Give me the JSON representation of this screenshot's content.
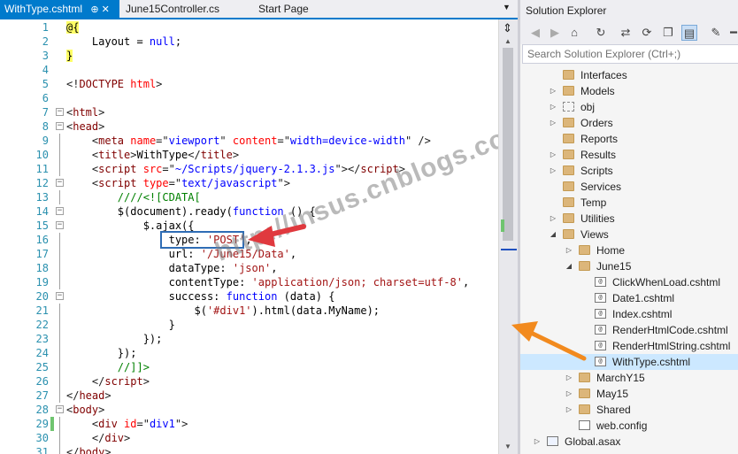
{
  "tabs": [
    {
      "label": "WithType.cshtml",
      "icons": "⊕ ✕"
    },
    {
      "label": "June15Controller.cs"
    },
    {
      "label": "Start Page"
    }
  ],
  "code": [
    {
      "num": "1",
      "tokens": [
        {
          "t": "@{",
          "c": "razor"
        }
      ]
    },
    {
      "num": "2",
      "tokens": [
        {
          "t": "    Layout = ",
          "c": "r"
        },
        {
          "t": "null",
          "c": "k"
        },
        {
          "t": ";",
          "c": "r"
        }
      ]
    },
    {
      "num": "3",
      "tokens": [
        {
          "t": "}",
          "c": "razor"
        }
      ]
    },
    {
      "num": "4",
      "tokens": []
    },
    {
      "num": "5",
      "tokens": [
        {
          "t": "<!",
          "c": "p"
        },
        {
          "t": "DOCTYPE",
          "c": "e"
        },
        {
          "t": " ",
          "c": "r"
        },
        {
          "t": "html",
          "c": "a"
        },
        {
          "t": ">",
          "c": "p"
        }
      ]
    },
    {
      "num": "6",
      "tokens": []
    },
    {
      "num": "7",
      "tokens": [
        {
          "t": "<",
          "c": "p"
        },
        {
          "t": "html",
          "c": "e"
        },
        {
          "t": ">",
          "c": "p"
        }
      ]
    },
    {
      "num": "8",
      "tokens": [
        {
          "t": "<",
          "c": "p"
        },
        {
          "t": "head",
          "c": "e"
        },
        {
          "t": ">",
          "c": "p"
        }
      ]
    },
    {
      "num": "9",
      "tokens": [
        {
          "t": "    <",
          "c": "p"
        },
        {
          "t": "meta",
          "c": "e"
        },
        {
          "t": " ",
          "c": "r"
        },
        {
          "t": "name",
          "c": "a"
        },
        {
          "t": "=\"",
          "c": "p"
        },
        {
          "t": "viewport",
          "c": "s"
        },
        {
          "t": "\"",
          "c": "p"
        },
        {
          "t": " ",
          "c": "r"
        },
        {
          "t": "content",
          "c": "a"
        },
        {
          "t": "=\"",
          "c": "p"
        },
        {
          "t": "width=device-width",
          "c": "s"
        },
        {
          "t": "\"",
          "c": "p"
        },
        {
          "t": " />",
          "c": "p"
        }
      ]
    },
    {
      "num": "10",
      "tokens": [
        {
          "t": "    <",
          "c": "p"
        },
        {
          "t": "title",
          "c": "e"
        },
        {
          "t": ">",
          "c": "p"
        },
        {
          "t": "WithType",
          "c": "r"
        },
        {
          "t": "</",
          "c": "p"
        },
        {
          "t": "title",
          "c": "e"
        },
        {
          "t": ">",
          "c": "p"
        }
      ]
    },
    {
      "num": "11",
      "tokens": [
        {
          "t": "    <",
          "c": "p"
        },
        {
          "t": "script",
          "c": "e"
        },
        {
          "t": " ",
          "c": "r"
        },
        {
          "t": "src",
          "c": "a"
        },
        {
          "t": "=\"",
          "c": "p"
        },
        {
          "t": "~/Scripts/jquery-2.1.3.js",
          "c": "s"
        },
        {
          "t": "\"",
          "c": "p"
        },
        {
          "t": "></",
          "c": "p"
        },
        {
          "t": "script",
          "c": "e"
        },
        {
          "t": ">",
          "c": "p"
        }
      ]
    },
    {
      "num": "12",
      "tokens": [
        {
          "t": "    <",
          "c": "p"
        },
        {
          "t": "script",
          "c": "e"
        },
        {
          "t": " ",
          "c": "r"
        },
        {
          "t": "type",
          "c": "a"
        },
        {
          "t": "=\"",
          "c": "p"
        },
        {
          "t": "text/javascript",
          "c": "s"
        },
        {
          "t": "\"",
          "c": "p"
        },
        {
          "t": ">",
          "c": "p"
        }
      ]
    },
    {
      "num": "13",
      "tokens": [
        {
          "t": "        ////<![CDATA[",
          "c": "c"
        }
      ]
    },
    {
      "num": "14",
      "tokens": [
        {
          "t": "        $(document).ready(",
          "c": "r"
        },
        {
          "t": "function",
          "c": "k"
        },
        {
          "t": " () {",
          "c": "r"
        }
      ]
    },
    {
      "num": "15",
      "tokens": [
        {
          "t": "            $.ajax({",
          "c": "r"
        }
      ]
    },
    {
      "num": "16",
      "tokens": [
        {
          "t": "                type: ",
          "c": "r"
        },
        {
          "t": "'POST'",
          "c": "v"
        },
        {
          "t": ",",
          "c": "r"
        }
      ]
    },
    {
      "num": "17",
      "tokens": [
        {
          "t": "                url: ",
          "c": "r"
        },
        {
          "t": "'/June15/Data'",
          "c": "v"
        },
        {
          "t": ",",
          "c": "r"
        }
      ]
    },
    {
      "num": "18",
      "tokens": [
        {
          "t": "                dataType: ",
          "c": "r"
        },
        {
          "t": "'json'",
          "c": "v"
        },
        {
          "t": ",",
          "c": "r"
        }
      ]
    },
    {
      "num": "19",
      "tokens": [
        {
          "t": "                contentType: ",
          "c": "r"
        },
        {
          "t": "'application/json; charset=utf-8'",
          "c": "v"
        },
        {
          "t": ",",
          "c": "r"
        }
      ]
    },
    {
      "num": "20",
      "tokens": [
        {
          "t": "                success: ",
          "c": "r"
        },
        {
          "t": "function",
          "c": "k"
        },
        {
          "t": " (data) {",
          "c": "r"
        }
      ]
    },
    {
      "num": "21",
      "tokens": [
        {
          "t": "                    $(",
          "c": "r"
        },
        {
          "t": "'#div1'",
          "c": "v"
        },
        {
          "t": ").html(data.MyName);",
          "c": "r"
        }
      ]
    },
    {
      "num": "22",
      "tokens": [
        {
          "t": "                }",
          "c": "r"
        }
      ]
    },
    {
      "num": "23",
      "tokens": [
        {
          "t": "            });",
          "c": "r"
        }
      ]
    },
    {
      "num": "24",
      "tokens": [
        {
          "t": "        });",
          "c": "r"
        }
      ]
    },
    {
      "num": "25",
      "tokens": [
        {
          "t": "        //]]>",
          "c": "c"
        }
      ]
    },
    {
      "num": "26",
      "tokens": [
        {
          "t": "    </",
          "c": "p"
        },
        {
          "t": "script",
          "c": "e"
        },
        {
          "t": ">",
          "c": "p"
        }
      ]
    },
    {
      "num": "27",
      "tokens": [
        {
          "t": "</",
          "c": "p"
        },
        {
          "t": "head",
          "c": "e"
        },
        {
          "t": ">",
          "c": "p"
        }
      ]
    },
    {
      "num": "28",
      "tokens": [
        {
          "t": "<",
          "c": "p"
        },
        {
          "t": "body",
          "c": "e"
        },
        {
          "t": ">",
          "c": "p"
        }
      ]
    },
    {
      "num": "29",
      "tokens": [
        {
          "t": "    <",
          "c": "p"
        },
        {
          "t": "div",
          "c": "e"
        },
        {
          "t": " ",
          "c": "r"
        },
        {
          "t": "id",
          "c": "a"
        },
        {
          "t": "=\"",
          "c": "p"
        },
        {
          "t": "div1",
          "c": "s"
        },
        {
          "t": "\"",
          "c": "p"
        },
        {
          "t": ">",
          "c": "p"
        }
      ]
    },
    {
      "num": "30",
      "tokens": [
        {
          "t": "    </",
          "c": "p"
        },
        {
          "t": "div",
          "c": "e"
        },
        {
          "t": ">",
          "c": "p"
        }
      ]
    },
    {
      "num": "31",
      "tokens": [
        {
          "t": "</",
          "c": "p"
        },
        {
          "t": "body",
          "c": "e"
        },
        {
          "t": ">",
          "c": "p"
        }
      ]
    }
  ],
  "watermark": "http://insus.cnblogs.com",
  "solution_explorer": {
    "title": "Solution Explorer",
    "search_placeholder": "Search Solution Explorer (Ctrl+;)",
    "toolbar_icons": [
      "back-icon",
      "forward-icon",
      "home-icon",
      "history-icon",
      "sync-icon",
      "refresh-icon",
      "collapse-all-icon",
      "show-all-files-icon",
      "properties-icon",
      "pin-icon"
    ],
    "items": [
      {
        "label": "Interfaces",
        "icon": "folder",
        "exp": ""
      },
      {
        "label": "Models",
        "icon": "folder",
        "exp": "▷"
      },
      {
        "label": "obj",
        "icon": "dashed",
        "exp": "▷"
      },
      {
        "label": "Orders",
        "icon": "folder",
        "exp": "▷"
      },
      {
        "label": "Reports",
        "icon": "folder",
        "exp": ""
      },
      {
        "label": "Results",
        "icon": "folder",
        "exp": "▷"
      },
      {
        "label": "Scripts",
        "icon": "folder",
        "exp": "▷"
      },
      {
        "label": "Services",
        "icon": "folder",
        "exp": ""
      },
      {
        "label": "Temp",
        "icon": "folder",
        "exp": ""
      },
      {
        "label": "Utilities",
        "icon": "folder",
        "exp": "▷"
      },
      {
        "label": "Views",
        "icon": "folder",
        "exp": "◢"
      },
      {
        "label": "Home",
        "icon": "folder",
        "exp": "▷"
      },
      {
        "label": "June15",
        "icon": "folder",
        "exp": "◢"
      },
      {
        "label": "ClickWhenLoad.cshtml",
        "icon": "cshtml",
        "exp": ""
      },
      {
        "label": "Date1.cshtml",
        "icon": "cshtml",
        "exp": ""
      },
      {
        "label": "Index.cshtml",
        "icon": "cshtml",
        "exp": ""
      },
      {
        "label": "RenderHtmlCode.cshtml",
        "icon": "cshtml",
        "exp": ""
      },
      {
        "label": "RenderHtmlString.cshtml",
        "icon": "cshtml",
        "exp": ""
      },
      {
        "label": "WithType.cshtml",
        "icon": "cshtml",
        "exp": "",
        "selected": true
      },
      {
        "label": "MarchY15",
        "icon": "folder",
        "exp": "▷"
      },
      {
        "label": "May15",
        "icon": "folder",
        "exp": "▷"
      },
      {
        "label": "Shared",
        "icon": "folder",
        "exp": "▷"
      },
      {
        "label": "web.config",
        "icon": "cfg",
        "exp": ""
      },
      {
        "label": "Global.asax",
        "icon": "asax",
        "exp": "▷"
      }
    ]
  },
  "colors": {
    "accent": "#007acc",
    "selection": "#cce8ff",
    "arrow_red": "#e0393e",
    "arrow_orange": "#f28a1e",
    "highlight_box": "#2f6db5"
  }
}
